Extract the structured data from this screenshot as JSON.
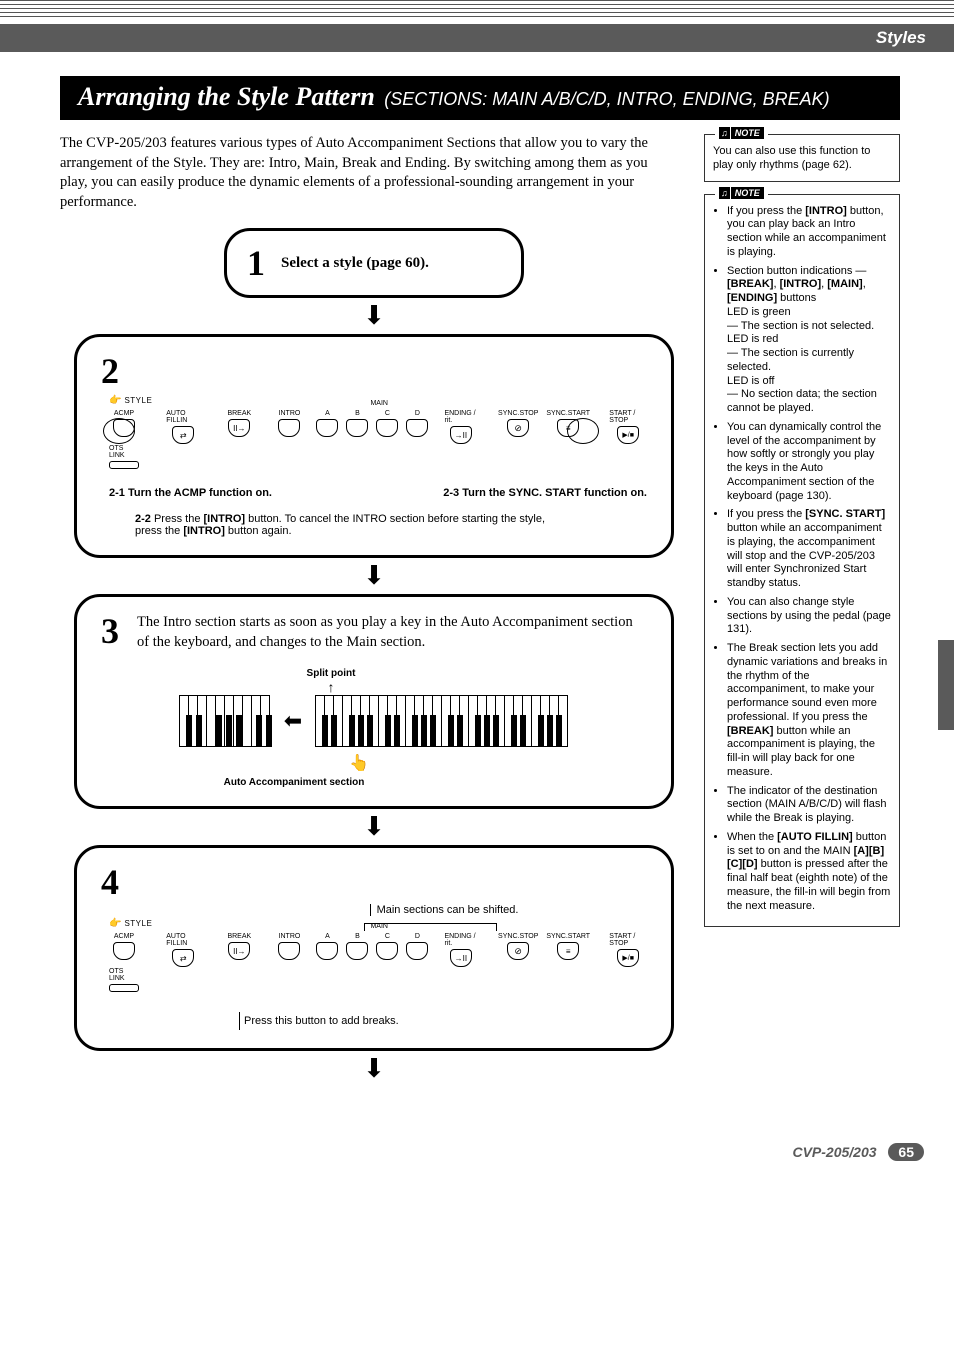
{
  "header": {
    "category": "Styles"
  },
  "title": {
    "main": "Arranging the Style Pattern",
    "sub": "(SECTIONS: MAIN A/B/C/D, INTRO, ENDING, BREAK)"
  },
  "intro": "The CVP-205/203 features various types of Auto Accompaniment Sections that allow you to vary the arrangement of the Style. They are: Intro, Main, Break and Ending. By switching among them as you play, you can easily produce the dynamic elements of a professional-sounding arrangement in your performance.",
  "note1": {
    "label": "NOTE",
    "text": "You can also use this function to play only rhythms (page 62)."
  },
  "note2": {
    "label": "NOTE",
    "items": [
      "If you press the [INTRO] button, you can play back an Intro section while an accompaniment is playing.",
      "Section button indications — [BREAK], [INTRO], [MAIN], [ENDING] buttons\nLED is green\n— The section is not selected.\nLED is red\n— The section is currently selected.\nLED is off\n— No section data; the section cannot be played.",
      "You can dynamically control the level of the accompaniment by how softly or strongly you play the keys in the Auto Accompaniment section of the keyboard (page 130).",
      "If you press the [SYNC. START] button while an accompaniment is playing, the accompaniment will stop and the CVP-205/203 will enter Synchronized Start standby status.",
      "You can also change style sections by using the pedal (page 131).",
      "The Break section lets you add dynamic variations and breaks in the rhythm of the accompaniment, to make your performance sound even more professional. If you press the [BREAK] button while an accompaniment is playing, the fill-in will play back for one measure.",
      "The indicator of the destination section (MAIN A/B/C/D) will flash while the Break is playing.",
      "When the [AUTO FILLIN] button is set to on and the MAIN [A][B][C][D] button is pressed after the final half beat (eighth note) of the measure, the fill-in will begin from the next measure."
    ]
  },
  "steps": {
    "s1": {
      "num": "1",
      "text": "Select a style (page 60)."
    },
    "s2": {
      "num": "2",
      "style_label": "STYLE",
      "btn_labels": {
        "acmp": "ACMP",
        "autofill": "AUTO FILLIN",
        "break": "BREAK",
        "intro": "INTRO",
        "main": "MAIN",
        "a": "A",
        "b": "B",
        "c": "C",
        "d": "D",
        "ending": "ENDING / rit.",
        "syncstop": "SYNC.STOP",
        "syncstart": "SYNC.START",
        "startstop": "START / STOP",
        "otslink": "OTS LINK"
      },
      "c21_num": "2-1",
      "c21": "Turn the ACMP function on.",
      "c23_num": "2-3",
      "c23": "Turn the SYNC. START function on.",
      "c22_num": "2-2",
      "c22a": "Press the ",
      "c22_btn": "[INTRO]",
      "c22b": " button. To cancel the INTRO section before starting the style, press the ",
      "c22_btn2": "[INTRO]",
      "c22c": " button again."
    },
    "s3": {
      "num": "3",
      "text": "The Intro section starts as soon as you play a key in the Auto Accompaniment section of the keyboard, and changes to the Main section.",
      "split": "Split point",
      "aac": "Auto Accompaniment section"
    },
    "s4": {
      "num": "4",
      "style_label": "STYLE",
      "mainshift": "Main sections can be shifted.",
      "breaks": "Press this button to add breaks."
    }
  },
  "footer": {
    "model": "CVP-205/203",
    "page": "65"
  }
}
